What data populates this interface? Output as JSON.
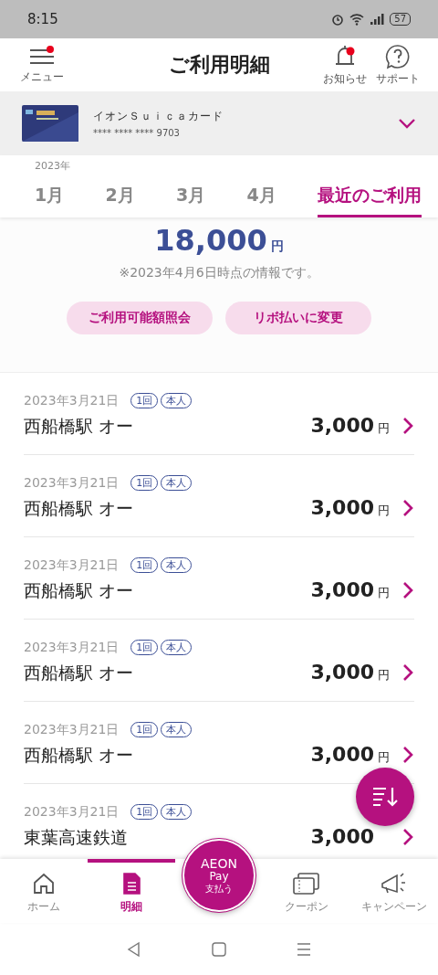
{
  "status_bar": {
    "time": "8:15",
    "battery": "57"
  },
  "header": {
    "menu": {
      "label": "メニュー",
      "badge": true
    },
    "title": "ご利用明細",
    "actions": [
      {
        "kind": "bell",
        "label": "お知らせ",
        "badge": true
      },
      {
        "kind": "help",
        "label": "サポート",
        "badge": false
      }
    ]
  },
  "card": {
    "name": "イオンＳｕｉｃａカード",
    "number": "**** **** **** 9703"
  },
  "year": "2023年",
  "tabs": [
    {
      "label": "1月",
      "selected": false
    },
    {
      "label": "2月",
      "selected": false
    },
    {
      "label": "3月",
      "selected": false
    },
    {
      "label": "4月",
      "selected": false
    },
    {
      "label": "最近のご利用",
      "selected": true
    }
  ],
  "summary": {
    "amount": "18,000",
    "unit": "円",
    "note": "※2023年4月6日時点の情報です。",
    "buttons": [
      "ご利用可能額照会",
      "リボ払いに変更"
    ]
  },
  "rows": [
    {
      "date": "2023年3月21日",
      "tags": [
        "1回",
        "本人"
      ],
      "name": "西船橋駅 オー",
      "amount": "3,000",
      "unit": "円"
    },
    {
      "date": "2023年3月21日",
      "tags": [
        "1回",
        "本人"
      ],
      "name": "西船橋駅 オー",
      "amount": "3,000",
      "unit": "円"
    },
    {
      "date": "2023年3月21日",
      "tags": [
        "1回",
        "本人"
      ],
      "name": "西船橋駅 オー",
      "amount": "3,000",
      "unit": "円"
    },
    {
      "date": "2023年3月21日",
      "tags": [
        "1回",
        "本人"
      ],
      "name": "西船橋駅 オー",
      "amount": "3,000",
      "unit": "円"
    },
    {
      "date": "2023年3月21日",
      "tags": [
        "1回",
        "本人"
      ],
      "name": "西船橋駅 オー",
      "amount": "3,000",
      "unit": "円"
    },
    {
      "date": "2023年3月21日",
      "tags": [
        "1回",
        "本人"
      ],
      "name": "東葉高速鉄道",
      "amount": "3,000"
    }
  ],
  "bottom_nav": [
    {
      "kind": "home",
      "label": "ホーム",
      "selected": false
    },
    {
      "kind": "statement",
      "label": "明細",
      "selected": true
    },
    {
      "kind": "pay",
      "logo": "AEON",
      "label": "Pay",
      "caption": "支払う"
    },
    {
      "kind": "coupon",
      "label": "クーポン",
      "selected": false
    },
    {
      "kind": "campaign",
      "label": "キャンペーン",
      "selected": false
    }
  ]
}
